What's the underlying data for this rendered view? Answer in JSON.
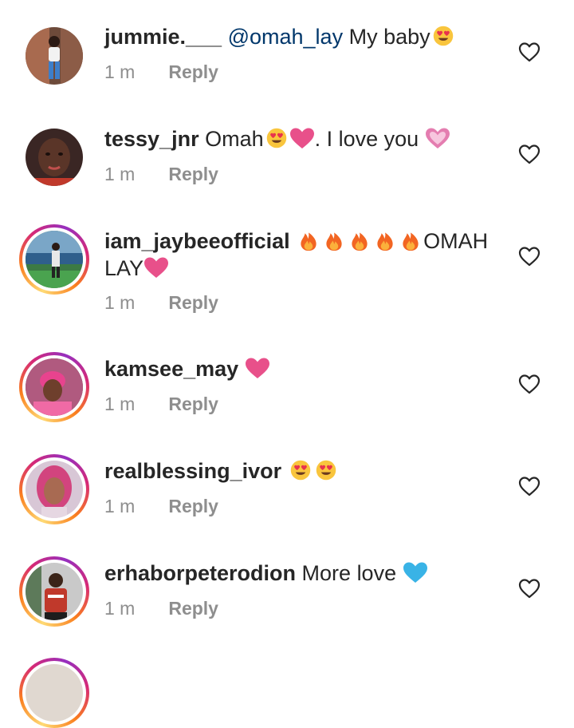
{
  "comments": [
    {
      "username": "jummie.___",
      "mention": "@omah_lay",
      "text": "My baby",
      "emojis": [
        "heart-eyes-emoji"
      ],
      "time": "1 m",
      "reply_label": "Reply"
    },
    {
      "username": "tessy_jnr",
      "text": "Omah",
      "text2": ". I love you",
      "emojis": [
        "heart-eyes-emoji",
        "pink-heart-emoji",
        "sparkling-heart-emoji"
      ],
      "time": "1 m",
      "reply_label": "Reply"
    },
    {
      "username": "iam_jaybeeofficial",
      "text": "OMAH",
      "text2": "LAY",
      "emojis": [
        "fire-emoji",
        "fire-emoji",
        "fire-emoji",
        "fire-emoji",
        "fire-emoji",
        "pink-heart-emoji"
      ],
      "time": "1 m",
      "reply_label": "Reply"
    },
    {
      "username": "kamsee_may",
      "emojis": [
        "pink-heart-emoji"
      ],
      "time": "1 m",
      "reply_label": "Reply"
    },
    {
      "username": "realblessing_ivor",
      "emojis": [
        "heart-eyes-emoji",
        "heart-eyes-emoji"
      ],
      "time": "1 m",
      "reply_label": "Reply"
    },
    {
      "username": "erhaborpeterodion",
      "text": "More love",
      "emojis": [
        "blue-heart-emoji"
      ],
      "time": "1 m",
      "reply_label": "Reply"
    }
  ],
  "colors": {
    "username": "#262626",
    "mention": "#00376b",
    "meta": "#8e8e8e",
    "pink_heart": "#e8508a",
    "blue_heart": "#39b3e6",
    "story_ring": "#d62976"
  },
  "icons": {
    "like": "heart-outline-icon"
  }
}
